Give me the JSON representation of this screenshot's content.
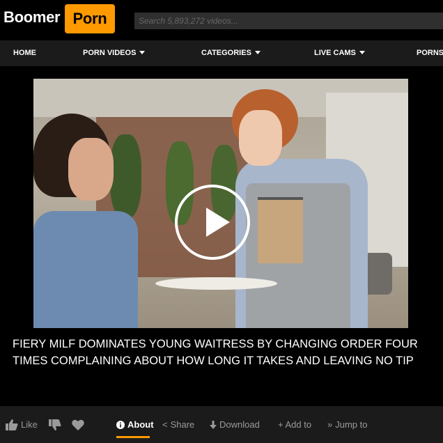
{
  "header": {
    "logo_left": "Boomer",
    "logo_right": "Porn",
    "search_placeholder": "Search 5,893,272 videos...",
    "brand_color": "#ff9900"
  },
  "nav": {
    "items": [
      {
        "label": "HOME",
        "has_caret": false
      },
      {
        "label": "PORN VIDEOS",
        "has_caret": true
      },
      {
        "label": "CATEGORIES",
        "has_caret": true
      },
      {
        "label": "LIVE CAMS",
        "has_caret": true
      },
      {
        "label": "PORNS",
        "has_caret": false
      }
    ]
  },
  "video": {
    "title": "FIERY MILF DOMINATES YOUNG WAITRESS BY CHANGING ORDER FOUR TIMES COMPLAINING ABOUT HOW LONG IT TAKES AND LEAVING NO TIP",
    "play_icon": "play-icon"
  },
  "actions": {
    "like": "Like",
    "dislike_icon": "thumbs-down-icon",
    "favorite_icon": "heart-icon",
    "about": "About",
    "share": "Share",
    "download": "Download",
    "add_to": "+ Add to",
    "jump_to": "Jump to"
  }
}
